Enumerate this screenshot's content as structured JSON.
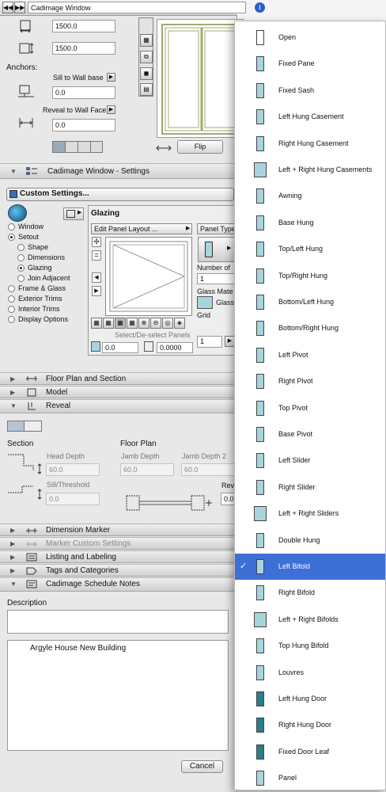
{
  "header": {
    "title": "Cadimage Window"
  },
  "dims": {
    "width": "1500.0",
    "height": "1500.0"
  },
  "anchors": {
    "label": "Anchors:",
    "sill_label": "Sill to Wall base",
    "sill_value": "0.0",
    "reveal_label": "Reveal to Wall Face",
    "reveal_value": "0.0"
  },
  "preview": {
    "flip_label": "Flip"
  },
  "settings": {
    "section_label": "Cadimage Window - Settings",
    "custom_label": "Custom Settings...",
    "tree": [
      "Window",
      "Setout",
      "Shape",
      "Dimensions",
      "Glazing",
      "Join Adjacent",
      "Frame & Glass",
      "Exterior Trims",
      "Interior Trims",
      "Display Options"
    ],
    "glazing": {
      "title": "Glazing",
      "edit_layout": "Edit Panel Layout ...",
      "panel_type": "Panel Type",
      "number_of": "Number of",
      "count": "1",
      "glass_material": "Glass Mate",
      "glass": "Glass",
      "grid": "Grid",
      "grid_value": "1",
      "select_hint": "Select/De-select Panels",
      "val1": "0.0",
      "val2": "0.0000"
    }
  },
  "sections": {
    "floor_plan": "Floor Plan and Section",
    "model": "Model",
    "reveal": "Reveal",
    "dimension_marker": "Dimension Marker",
    "marker_custom": "Marker Custom Settings",
    "listing": "Listing and Labeling",
    "tags": "Tags and Categories",
    "schedule_notes": "Cadimage Schedule Notes"
  },
  "reveal": {
    "section_label": "Section",
    "head_depth": "Head Depth",
    "head_value": "60.0",
    "sill_threshold": "Sill/Threshold",
    "sill_value": "0.0",
    "floor_plan_label": "Floor Plan",
    "jamb_depth": "Jamb Depth",
    "jamb_value": "60.0",
    "jamb_depth2": "Jamb Depth 2",
    "jamb2_value": "60.0",
    "rev_label": "Reve",
    "rev_value": "0.0"
  },
  "notes": {
    "description_label": "Description",
    "note_text": "Argyle House New Building"
  },
  "footer": {
    "cancel_label": "Cancel"
  },
  "menu": {
    "items": [
      "Open",
      "Fixed Pane",
      "Fixed Sash",
      "Left Hung Casement",
      "Right Hung Casement",
      "Left + Right Hung Casements",
      "Awning",
      "Base Hung",
      "Top/Left Hung",
      "Top/Right Hung",
      "Bottom/Left Hung",
      "Bottom/Right Hung",
      "Left Pivot",
      "Right Pivot",
      "Top Pivot",
      "Base Pivot",
      "Left Slider",
      "Right Slider",
      "Left + Right Sliders",
      "Double Hung",
      "Left Bifold",
      "Right Bifold",
      "Left + Right Bifolds",
      "Top Hung Bifold",
      "Louvres",
      "Left Hung Door",
      "Right Hung Door",
      "Fixed Door Leaf",
      "Panel"
    ],
    "selected_index": 20,
    "checkmark": "✓"
  },
  "colors": {
    "accent": "#3d6fd6",
    "glass": "#a8d4dc"
  }
}
